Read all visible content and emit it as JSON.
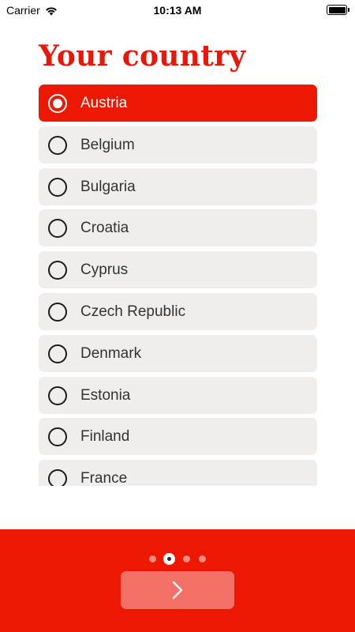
{
  "status_bar": {
    "carrier": "Carrier",
    "time": "10:13 AM",
    "wifi_icon": "wifi-icon",
    "battery_icon": "battery-icon",
    "battery_level": 1.0
  },
  "title": "Your country",
  "countries": {
    "selected_index": 0,
    "items": [
      {
        "label": "Austria",
        "selected": true
      },
      {
        "label": "Belgium",
        "selected": false
      },
      {
        "label": "Bulgaria",
        "selected": false
      },
      {
        "label": "Croatia",
        "selected": false
      },
      {
        "label": "Cyprus",
        "selected": false
      },
      {
        "label": "Czech Republic",
        "selected": false
      },
      {
        "label": "Denmark",
        "selected": false
      },
      {
        "label": "Estonia",
        "selected": false
      },
      {
        "label": "Finland",
        "selected": false
      },
      {
        "label": "France",
        "selected": false
      }
    ]
  },
  "pager": {
    "page_count": 4,
    "current_page": 2
  },
  "next_button": {
    "icon": "chevron-right-icon"
  },
  "colors": {
    "accent": "#ec1803",
    "title": "#e8170a",
    "option_bg": "#efeeed",
    "next_button_bg": "#f37066"
  }
}
